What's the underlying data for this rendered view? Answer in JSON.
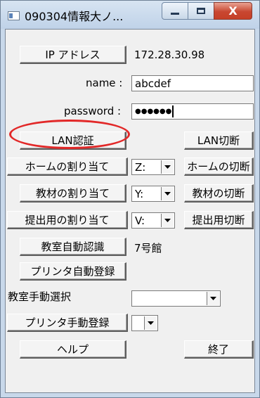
{
  "window": {
    "title": "090304情報大ノ...",
    "close_glyph": "X"
  },
  "form": {
    "ip_button": "IP アドレス",
    "ip_value": "172.28.30.98",
    "name_label": "name :",
    "name_value": "abcdef",
    "password_label": "password :",
    "password_value": "●●●●●●",
    "lan_auth_button": "LAN認証",
    "lan_disconnect_button": "LAN切断",
    "home_assign_button": "ホームの割り当て",
    "home_drive": "Z:",
    "home_disconnect_button": "ホームの切断",
    "material_assign_button": "教材の割り当て",
    "material_drive": "Y:",
    "material_disconnect_button": "教材の切断",
    "submit_assign_button": "提出用の割り当て",
    "submit_drive": "V:",
    "submit_disconnect_button": "提出用切断",
    "classroom_auto_button": "教室自動認識",
    "classroom_value": "7号館",
    "printer_auto_button": "プリンタ自動登録",
    "classroom_manual_label": "教室手動選択",
    "classroom_manual_value": "",
    "printer_manual_button": "プリンタ手動登録",
    "printer_manual_value": "",
    "help_button": "ヘルプ",
    "exit_button": "終了"
  },
  "colors": {
    "annotation_circle": "#e22828",
    "close_button": "#c84731"
  }
}
